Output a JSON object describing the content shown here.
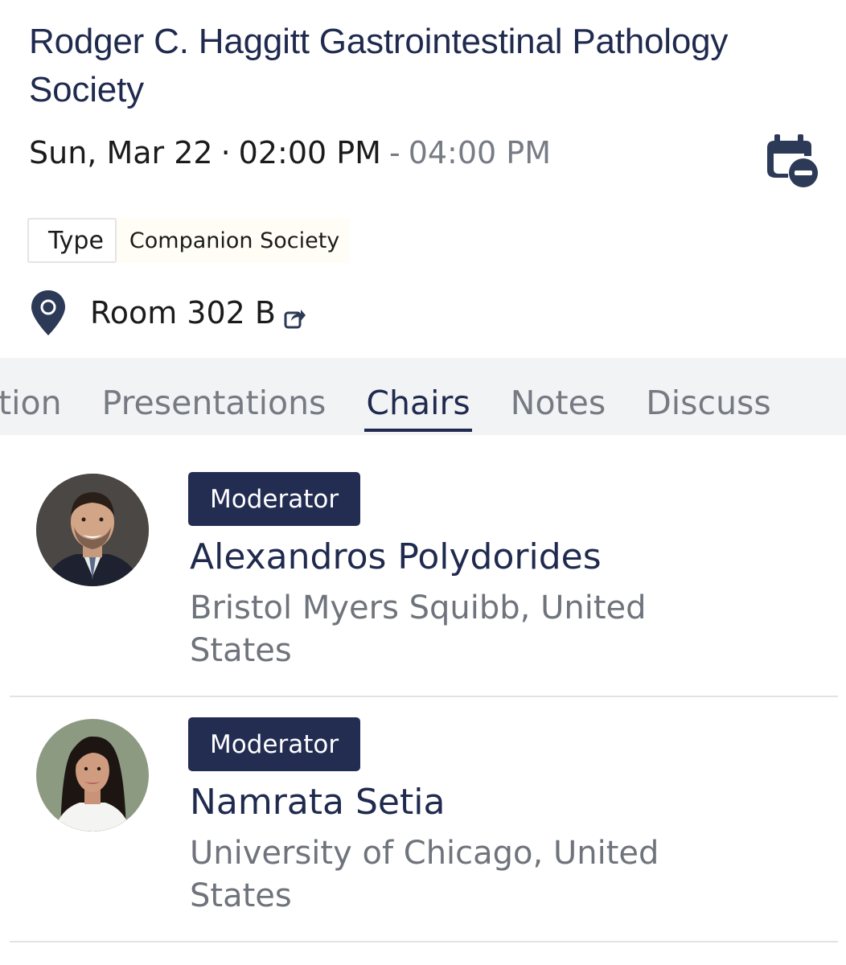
{
  "session": {
    "title": "Rodger C. Haggitt Gastrointestinal Pathology Society",
    "date": "Sun, Mar 22",
    "separator": "·",
    "start_time": "02:00 PM",
    "dash": "-",
    "end_time": "04:00 PM",
    "calendar_icon": "calendar-remove-icon"
  },
  "type": {
    "label": "Type",
    "value": "Companion Society"
  },
  "location": {
    "icon": "map-pin-icon",
    "room": "Room 302 B",
    "share_icon": "share-icon"
  },
  "tabs": [
    {
      "label": "Description",
      "visible_text": "ption",
      "active": false
    },
    {
      "label": "Presentations",
      "visible_text": "Presentations",
      "active": false
    },
    {
      "label": "Chairs",
      "visible_text": "Chairs",
      "active": true
    },
    {
      "label": "Notes",
      "visible_text": "Notes",
      "active": false
    },
    {
      "label": "Discuss",
      "visible_text": "Discuss",
      "active": false
    }
  ],
  "chairs": [
    {
      "role": "Moderator",
      "name": "Alexandros Polydorides",
      "org_line1": "Bristol Myers Squibb, United",
      "org_line2": "States"
    },
    {
      "role": "Moderator",
      "name": "Namrata Setia",
      "org_line1": "University of Chicago, United",
      "org_line2": "States"
    }
  ],
  "colors": {
    "primary_navy": "#1f2a4e",
    "badge_bg": "#232d52",
    "muted_text": "#6f737b",
    "tab_bar_bg": "#f2f3f5"
  }
}
